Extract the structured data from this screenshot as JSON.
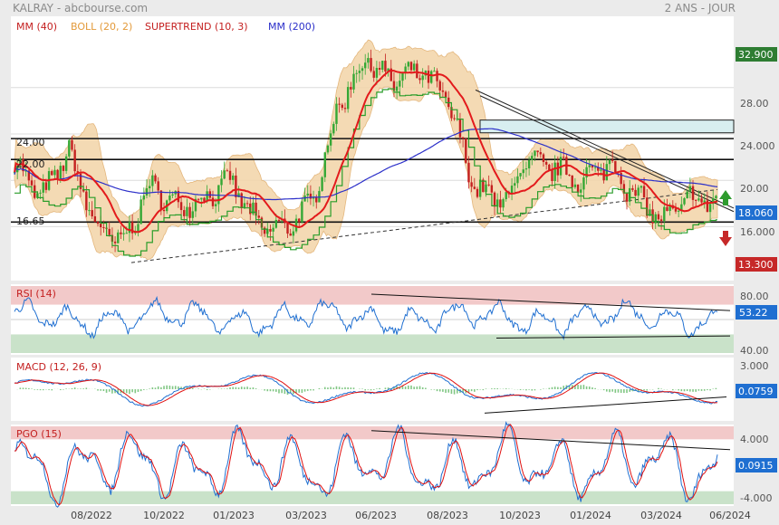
{
  "header": {
    "title": "KALRAY - abcbourse.com",
    "period": "2 ANS - JOUR"
  },
  "colors": {
    "bg": "#ebebeb",
    "panel": "#ffffff",
    "ma40": "#e31a1c",
    "boll_fill": "#f3d6ac",
    "boll_line": "#e2b070",
    "supertrend": "#2a9d2a",
    "ma200": "#2b2fc9",
    "candle_up": "#35a835",
    "candle_down": "#c42020",
    "rsi_line": "#1f6fd1",
    "signal_red": "#e01010",
    "overbought_zone": "#f2c9c9",
    "oversold_zone": "#c9e2c9",
    "badge_green": "#2e7d32",
    "badge_blue": "#1f6fd1",
    "badge_red": "#c62828"
  },
  "x_ticks": [
    "08/2022",
    "10/2022",
    "01/2023",
    "03/2023",
    "06/2023",
    "08/2023",
    "10/2023",
    "01/2024",
    "03/2024",
    "06/2024"
  ],
  "chart_data": [
    {
      "type": "candlestick",
      "legend": [
        {
          "label": "MM (40)",
          "color": "#e31a1c"
        },
        {
          "label": "BOLL (20, 2)",
          "color": "#e39a3a"
        },
        {
          "label": "SUPERTREND (10, 3)",
          "color": "#c42020"
        },
        {
          "label": "MM (200)",
          "color": "#2b2fc9"
        }
      ],
      "y_ticks": [
        "28.00",
        "24.000",
        "20.00",
        "16.000"
      ],
      "y_tick_values": [
        28,
        24,
        20,
        16
      ],
      "ylim": [
        11.5,
        34
      ],
      "levels": [
        {
          "label": "24.00",
          "value": 23.6
        },
        {
          "label": "22.00",
          "value": 21.8
        },
        {
          "label": "16.65",
          "value": 16.4
        }
      ],
      "badges": [
        {
          "label": "32.900",
          "value": 32.9,
          "color": "#2e7d32"
        },
        {
          "label": "18.060",
          "value": 18.06,
          "color": "#1f6fd1"
        },
        {
          "label": "13.300",
          "value": 13.3,
          "color": "#c62828"
        }
      ],
      "close_points": [
        {
          "x": "07/2022",
          "y": 21.5
        },
        {
          "x": "08/2022",
          "y": 18.5
        },
        {
          "x": "08/2022",
          "y": 22.5
        },
        {
          "x": "09/2022",
          "y": 16.0
        },
        {
          "x": "10/2022",
          "y": 14.5
        },
        {
          "x": "11/2022",
          "y": 19.5
        },
        {
          "x": "12/2022",
          "y": 17.8
        },
        {
          "x": "01/2023",
          "y": 18.4
        },
        {
          "x": "02/2023",
          "y": 20.0
        },
        {
          "x": "03/2023",
          "y": 16.0
        },
        {
          "x": "04/2023",
          "y": 15.8
        },
        {
          "x": "05/2023",
          "y": 18.0
        },
        {
          "x": "06/2023",
          "y": 26.5
        },
        {
          "x": "06/2023",
          "y": 30.5
        },
        {
          "x": "07/2023",
          "y": 28.5
        },
        {
          "x": "08/2023",
          "y": 29.5
        },
        {
          "x": "09/2023",
          "y": 27.0
        },
        {
          "x": "09/2023",
          "y": 19.5
        },
        {
          "x": "10/2023",
          "y": 18.0
        },
        {
          "x": "11/2023",
          "y": 21.5
        },
        {
          "x": "12/2023",
          "y": 21.0
        },
        {
          "x": "01/2024",
          "y": 20.0
        },
        {
          "x": "02/2024",
          "y": 21.5
        },
        {
          "x": "03/2024",
          "y": 18.5
        },
        {
          "x": "04/2024",
          "y": 16.5
        },
        {
          "x": "05/2024",
          "y": 18.5
        },
        {
          "x": "06/2024",
          "y": 18.06
        }
      ]
    },
    {
      "type": "line",
      "legend": [
        {
          "label": "RSI (14)",
          "color": "#c42020"
        }
      ],
      "y_ticks": [
        "80.00",
        "40.00"
      ],
      "y_tick_values": [
        80,
        40
      ],
      "ylim": [
        5,
        95
      ],
      "overbought": 70,
      "oversold": 30,
      "last_value": "53.22"
    },
    {
      "type": "line",
      "legend": [
        {
          "label": "MACD (12, 26, 9)",
          "color": "#c42020"
        }
      ],
      "y_ticks": [
        "3.000"
      ],
      "y_tick_values": [
        3
      ],
      "ylim": [
        -3.5,
        3.5
      ],
      "last_value": "0.0759"
    },
    {
      "type": "line",
      "legend": [
        {
          "label": "PGO (15)",
          "color": "#c42020"
        }
      ],
      "y_ticks": [
        "4.000",
        "-4.000"
      ],
      "y_tick_values": [
        4,
        -4
      ],
      "ylim": [
        -4.5,
        4.5
      ],
      "overbought": 3,
      "oversold": -3,
      "last_value": "0.0915"
    }
  ]
}
